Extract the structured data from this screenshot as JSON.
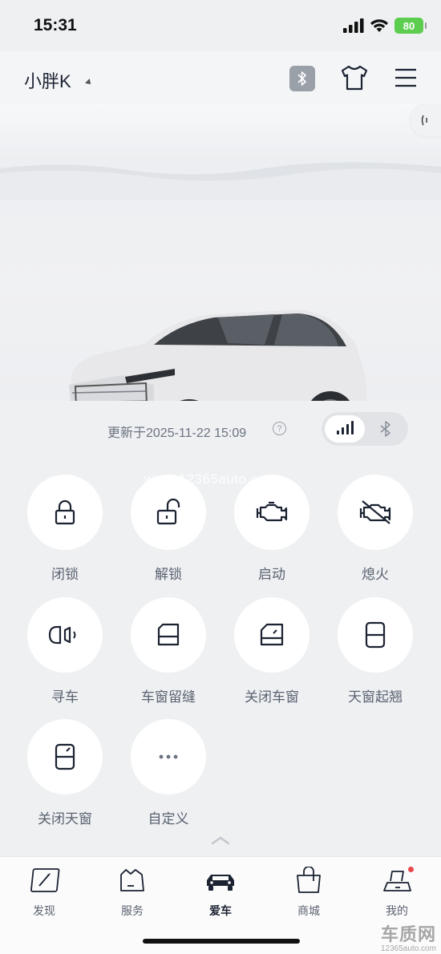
{
  "status_bar": {
    "time": "15:31",
    "battery": "80"
  },
  "header": {
    "car_name": "小胖K"
  },
  "vehicle": {
    "updated_text": "更新于2025-11-22 15:09",
    "help_glyph": "?"
  },
  "watermark": "www.12365auto.com",
  "actions": [
    {
      "label": "闭锁",
      "icon": "lock-icon"
    },
    {
      "label": "解锁",
      "icon": "unlock-icon"
    },
    {
      "label": "启动",
      "icon": "engine-start-icon"
    },
    {
      "label": "熄火",
      "icon": "engine-off-icon"
    },
    {
      "label": "寻车",
      "icon": "find-car-icon"
    },
    {
      "label": "车窗留缝",
      "icon": "window-vent-icon"
    },
    {
      "label": "关闭车窗",
      "icon": "window-close-icon"
    },
    {
      "label": "天窗起翘",
      "icon": "sunroof-tilt-icon"
    },
    {
      "label": "关闭天窗",
      "icon": "sunroof-close-icon"
    },
    {
      "label": "自定义",
      "icon": "more-icon"
    }
  ],
  "tabs": [
    {
      "label": "发现",
      "icon": "compass-icon"
    },
    {
      "label": "服务",
      "icon": "service-icon"
    },
    {
      "label": "爱车",
      "icon": "car-icon",
      "active": true
    },
    {
      "label": "商城",
      "icon": "shopping-bag-icon"
    },
    {
      "label": "我的",
      "icon": "profile-icon",
      "badge": true
    }
  ],
  "brand_mark": {
    "title": "车质网",
    "url": "12365auto.com"
  },
  "colors": {
    "accent": "#1b2231",
    "battery": "#5ccd4f",
    "badge": "#e5484d"
  }
}
